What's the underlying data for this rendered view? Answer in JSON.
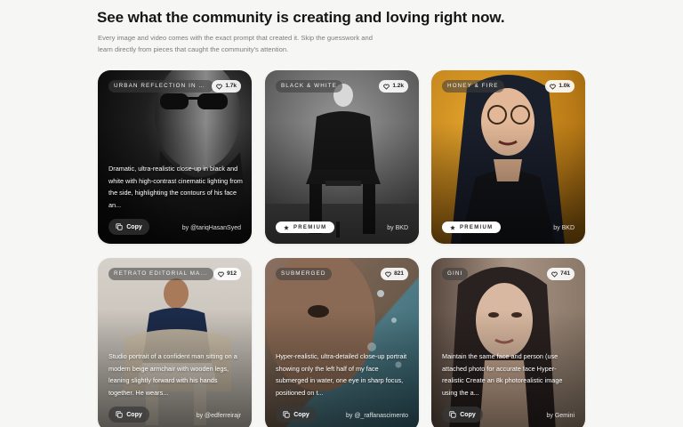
{
  "header": {
    "title": "See what the community is creating and loving right now.",
    "description": "Every image and video comes with the exact prompt that created it. Skip the guesswork and learn directly from pieces that caught the community's attention."
  },
  "cards": [
    {
      "tag": "URBAN REFLECTION IN D...",
      "likes": "1.7k",
      "prompt": "Dramatic, ultra-realistic close-up in black and white with high-contrast cinematic lighting from the side, highlighting the contours of his face an...",
      "action": "Copy",
      "author": "by @tariqHasanSyed",
      "bg": "#2a2a2a"
    },
    {
      "tag": "BLACK & WHITE",
      "likes": "1.2k",
      "badge": "PREMIUM",
      "author": "by BKD",
      "bg": "#6e6e6e"
    },
    {
      "tag": "HONEY & FIRE",
      "likes": "1.0k",
      "badge": "PREMIUM",
      "author": "by BKD",
      "bg": "#c78a1c"
    },
    {
      "tag": "RETRATO EDITORIAL MA...",
      "likes": "912",
      "prompt": "Studio portrait of a confident man sitting on a modern beige armchair with wooden legs, leaning slightly forward with his hands together. He wears...",
      "action": "Copy",
      "author": "by @edferreirajr",
      "bg": "#c9c4bd"
    },
    {
      "tag": "SUBMERGED",
      "likes": "821",
      "prompt": "Hyper-realistic, ultra-detailed close-up portrait showing only the left half of my face submerged in water, one eye in sharp focus, positioned on t...",
      "action": "Copy",
      "author": "by @_raffanascimento",
      "bg": "#5b7d86"
    },
    {
      "tag": "GINI",
      "likes": "741",
      "prompt": "Maintain the same face and person (use attached photo for accurate face Hyper-realistic Create an 8k photorealistic image using the a...",
      "action": "Copy",
      "author": "by Gemini",
      "bg": "#9b8a7c"
    }
  ]
}
